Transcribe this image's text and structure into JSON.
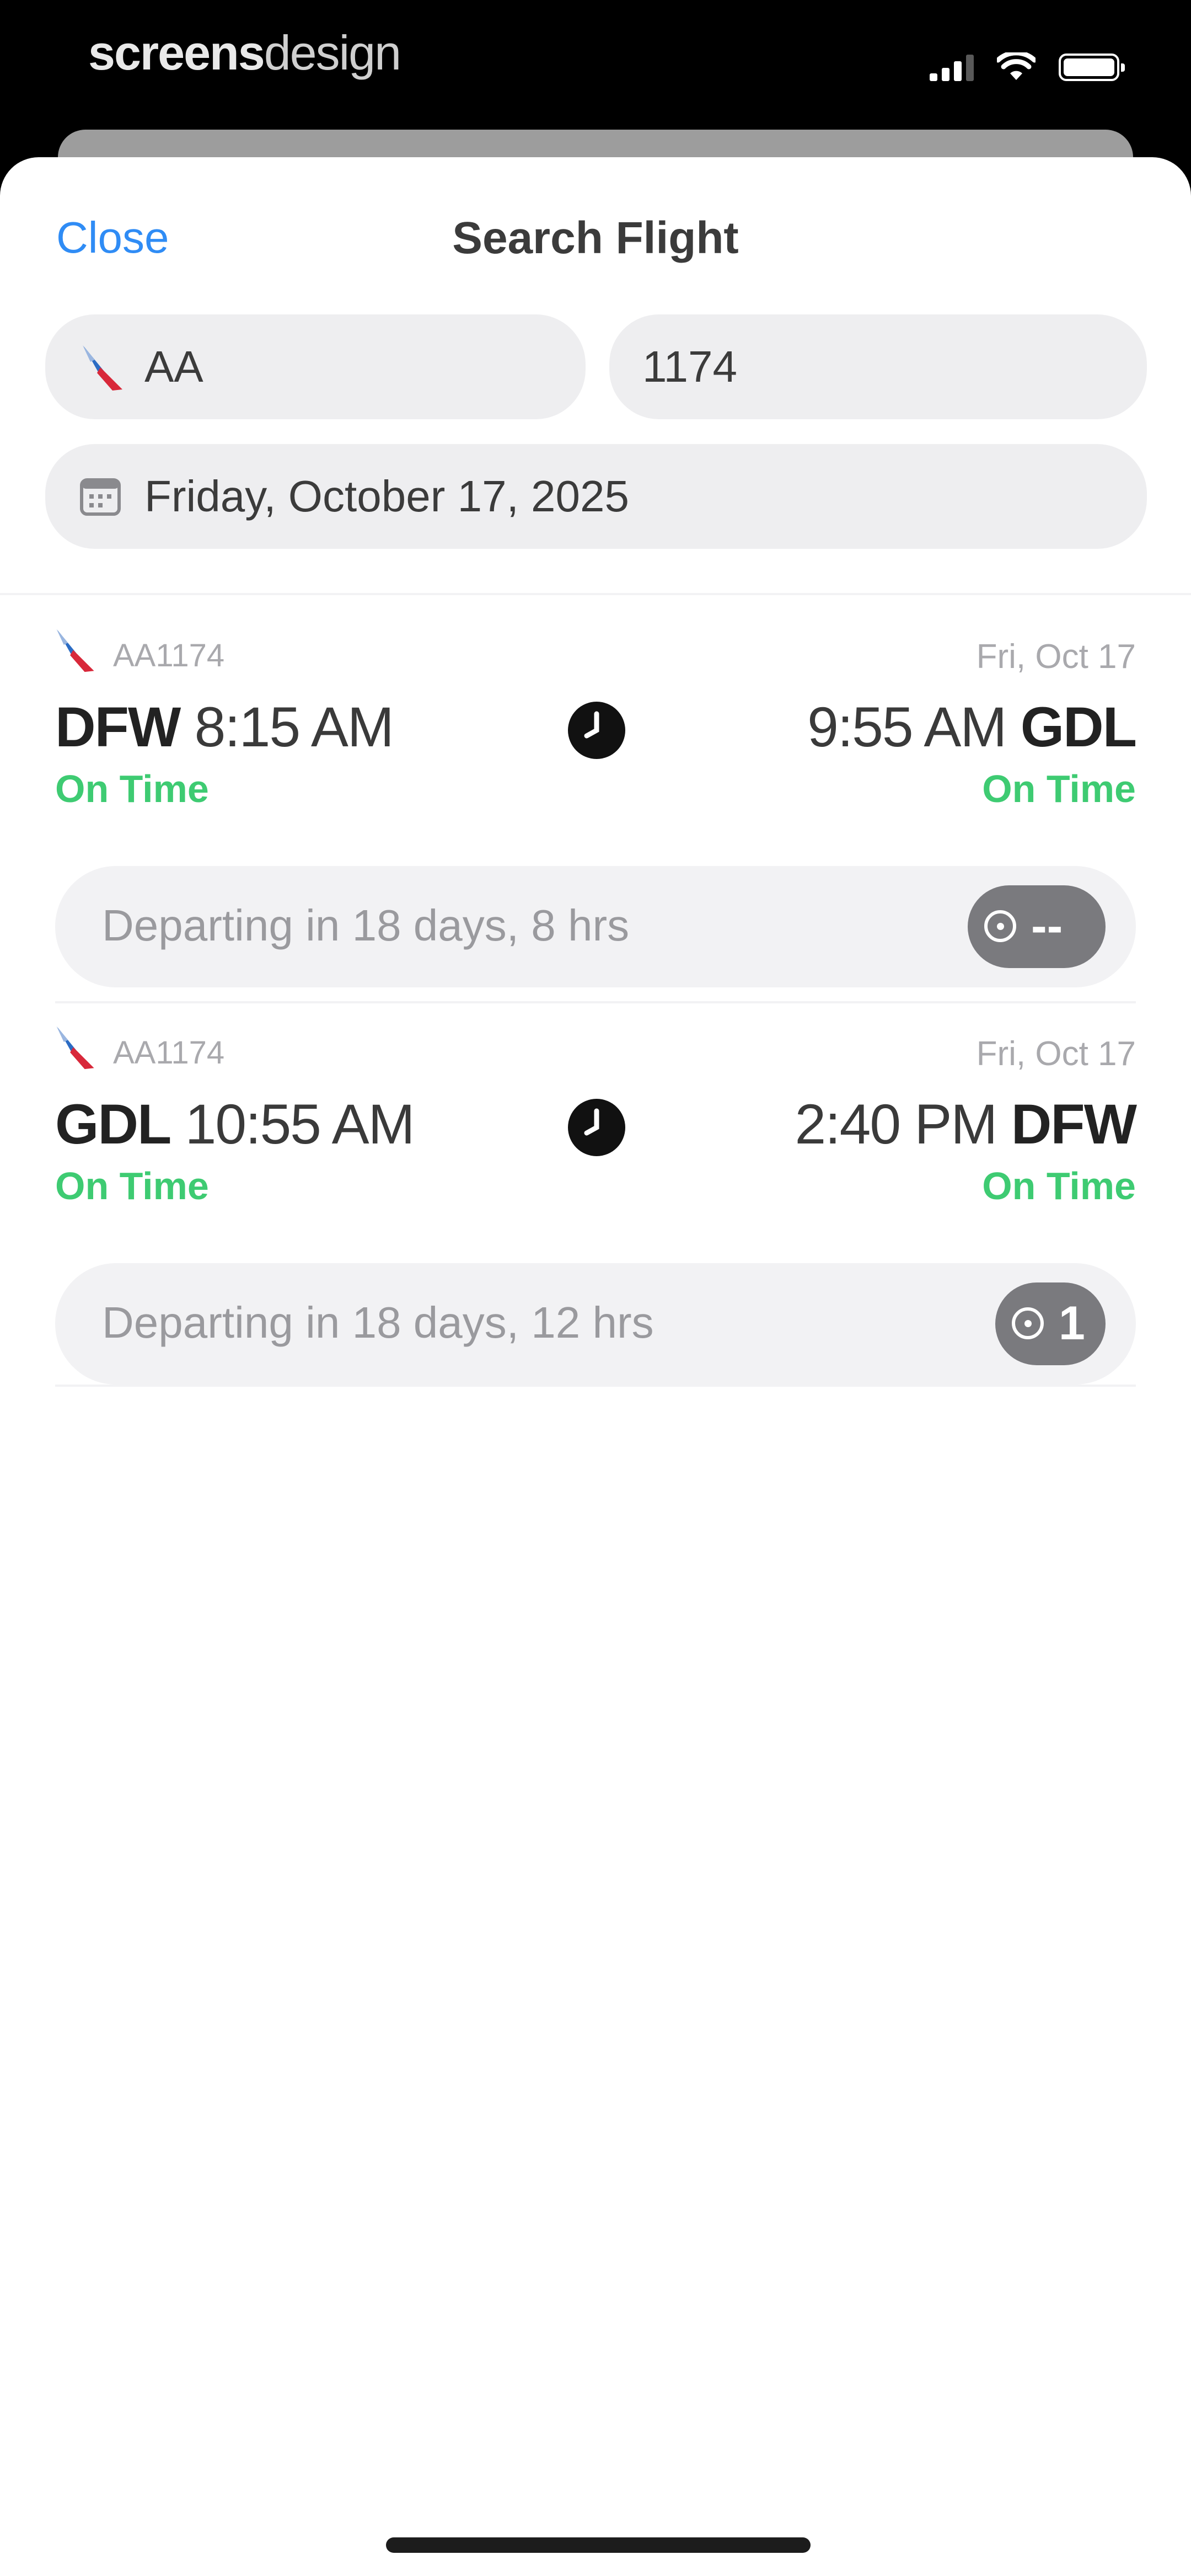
{
  "status_bar": {
    "brand_bold": "screens",
    "brand_light": "design"
  },
  "nav": {
    "close_label": "Close",
    "title": "Search Flight"
  },
  "search": {
    "airline_value": "AA",
    "flight_number_value": "1174",
    "date_value": "Friday, October 17, 2025"
  },
  "flights": [
    {
      "flight_number": "AA1174",
      "date": "Fri, Oct 17",
      "departure": {
        "code": "DFW",
        "time": "8:15 AM",
        "status": "On Time"
      },
      "arrival": {
        "code": "GDL",
        "time": "9:55 AM",
        "status": "On Time"
      },
      "departing_in": "Departing in 18 days, 8 hrs",
      "toggle_value": "--"
    },
    {
      "flight_number": "AA1174",
      "date": "Fri, Oct 17",
      "departure": {
        "code": "GDL",
        "time": "10:55 AM",
        "status": "On Time"
      },
      "arrival": {
        "code": "DFW",
        "time": "2:40 PM",
        "status": "On Time"
      },
      "departing_in": "Departing in 18 days, 12 hrs",
      "toggle_value": "1"
    }
  ],
  "colors": {
    "accent": "#2f8cf5",
    "on_time": "#3ecb72",
    "field_bg": "#eeeef0"
  },
  "icons": {
    "airline_logo": "american-airlines-icon",
    "calendar": "calendar-icon",
    "clock": "clock-icon",
    "toggle": "tracking-toggle-icon"
  }
}
